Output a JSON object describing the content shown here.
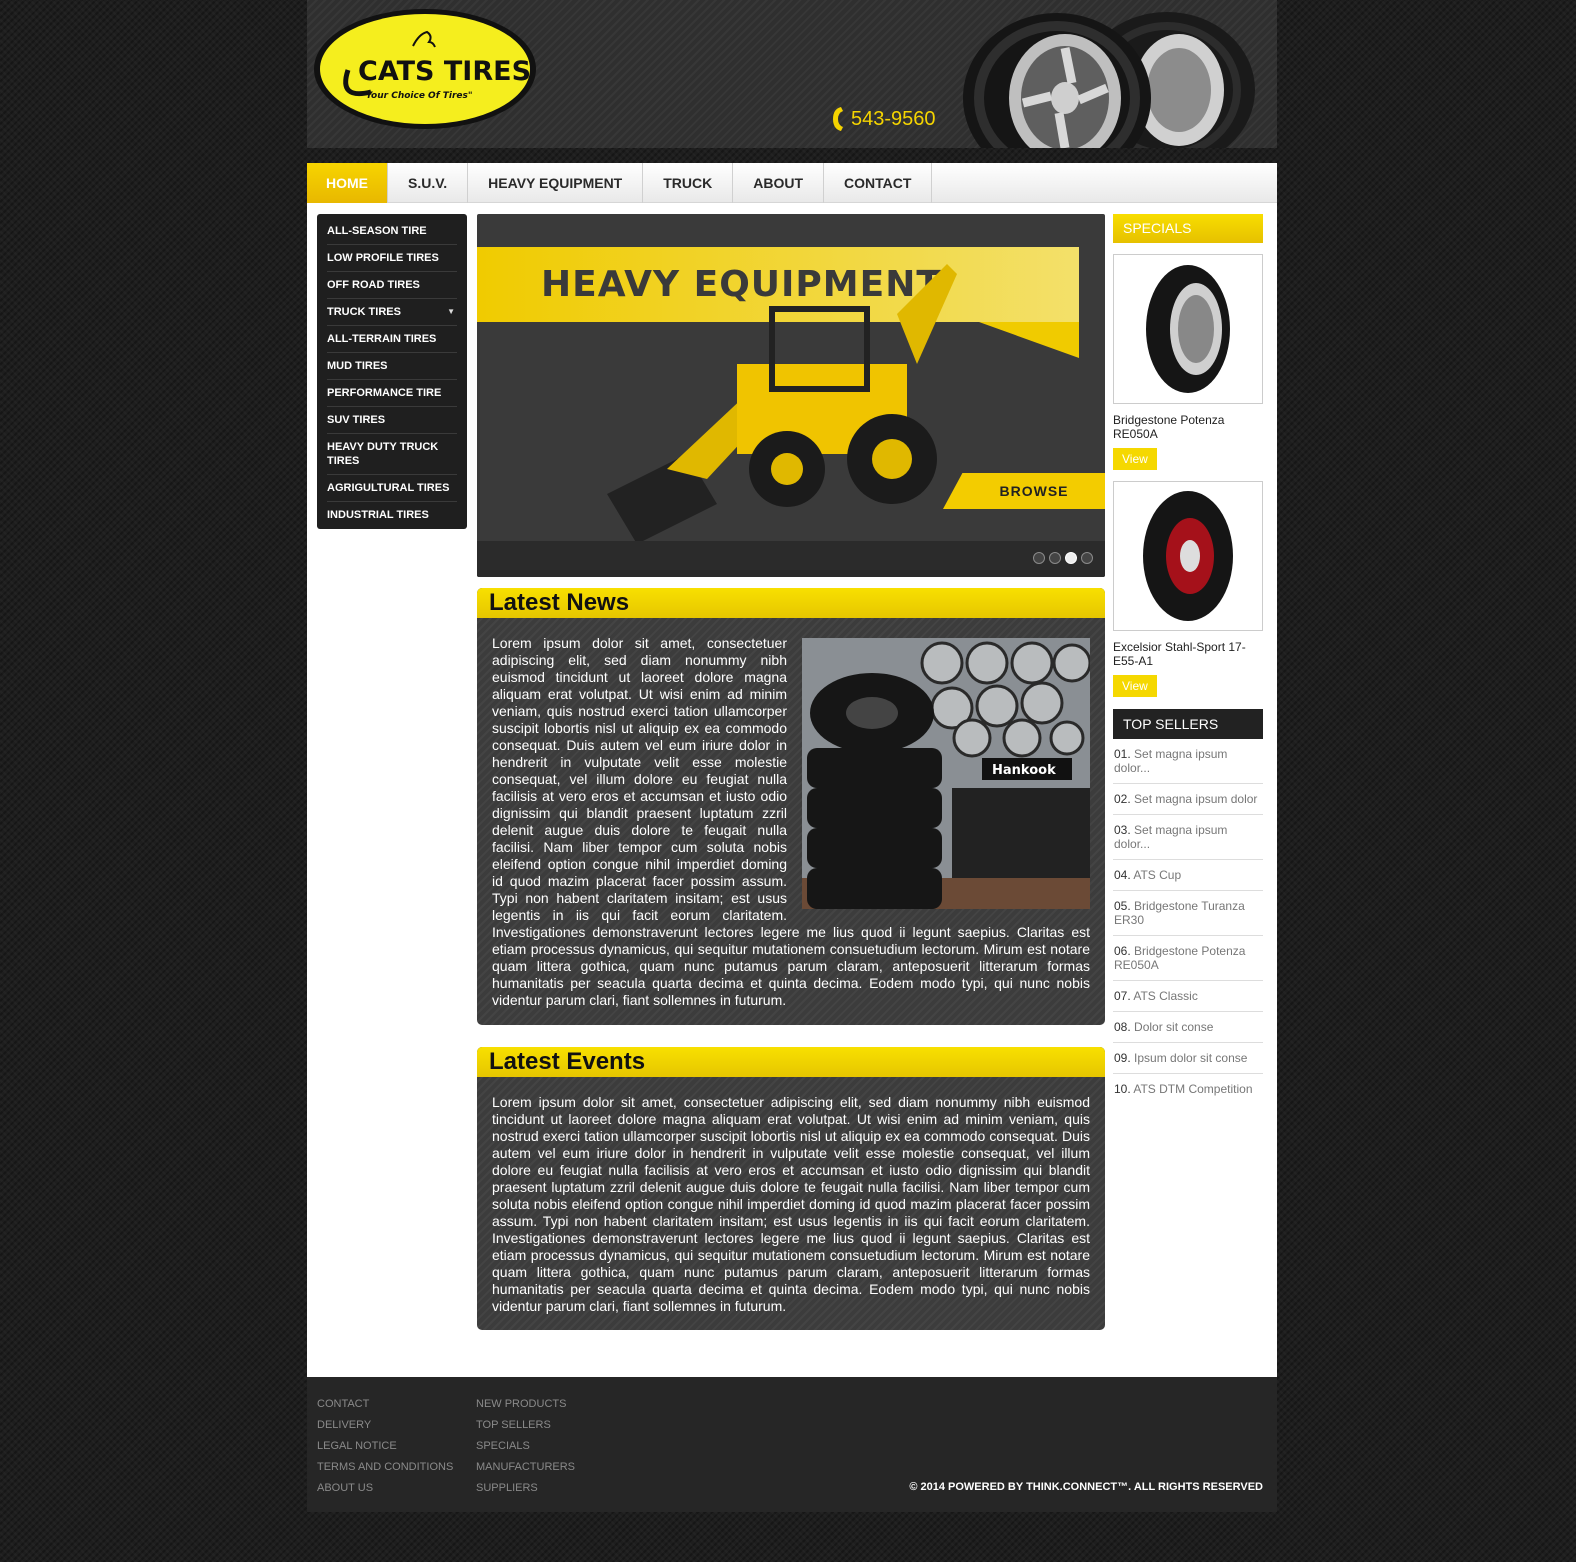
{
  "brand": {
    "name": "CATS TIRES",
    "tagline": "\"Your Choice Of Tires\"",
    "phone": "543-9560"
  },
  "nav": {
    "items": [
      "HOME",
      "S.U.V.",
      "HEAVY EQUIPMENT",
      "TRUCK",
      "ABOUT",
      "CONTACT"
    ],
    "active": "HOME"
  },
  "categories": [
    "ALL-SEASON TIRE",
    "LOW PROFILE TIRES",
    "OFF ROAD TIRES",
    "TRUCK TIRES",
    "ALL-TERRAIN TIRES",
    "MUD TIRES",
    "PERFORMANCE TIRE",
    "SUV TIRES",
    "HEAVY DUTY TRUCK TIRES",
    "AGRIGULTURAL TIRES",
    "INDUSTRIAL TIRES"
  ],
  "slider": {
    "title": "HEAVY EQUIPMENT",
    "button": "BROWSE",
    "dot_count": 4,
    "active_dot": 3
  },
  "news": {
    "title": "Latest News",
    "text": "Lorem ipsum dolor sit amet, consectetuer adipiscing elit, sed diam nonummy nibh euismod tincidunt ut laoreet dolore magna aliquam erat volutpat. Ut wisi enim ad minim veniam, quis nostrud exerci tation ullamcorper suscipit lobortis nisl ut aliquip ex ea commodo consequat. Duis autem vel eum iriure dolor in hendrerit in vulputate velit esse molestie consequat, vel illum dolore eu feugiat nulla facilisis at vero eros et accumsan et iusto odio dignissim qui blandit praesent luptatum zzril delenit augue duis dolore te feugait nulla facilisi. Nam liber tempor cum soluta nobis eleifend option congue nihil imperdiet doming id quod mazim placerat facer possim assum. Typi non habent claritatem insitam; est usus legentis in iis qui facit eorum claritatem. Investigationes demonstraverunt lectores legere me lius quod ii legunt saepius. Claritas est etiam processus dynamicus, qui sequitur mutationem consuetudium lectorum. Mirum est notare quam littera gothica, quam nunc putamus parum claram, anteposuerit litterarum formas humanitatis per seacula quarta decima et quinta decima. Eodem modo typi, qui nunc nobis videntur parum clari, fiant sollemnes in futurum."
  },
  "events": {
    "title": "Latest Events",
    "text": "Lorem ipsum dolor sit amet, consectetuer adipiscing elit, sed diam nonummy nibh euismod tincidunt ut laoreet dolore magna aliquam erat volutpat. Ut wisi enim ad minim veniam, quis nostrud exerci tation ullamcorper suscipit lobortis nisl ut aliquip ex ea commodo consequat. Duis autem vel eum iriure dolor in hendrerit in vulputate velit esse molestie consequat, vel illum dolore eu feugiat nulla facilisis at vero eros et accumsan et iusto odio dignissim qui blandit praesent luptatum zzril delenit augue duis dolore te feugait nulla facilisi. Nam liber tempor cum soluta nobis eleifend option congue nihil imperdiet doming id quod mazim placerat facer possim assum. Typi non habent claritatem insitam; est usus legentis in iis qui facit eorum claritatem. Investigationes demonstraverunt lectores legere me lius quod ii legunt saepius. Claritas est etiam processus dynamicus, qui sequitur mutationem consuetudium lectorum. Mirum est notare quam littera gothica, quam nunc putamus parum claram, anteposuerit litterarum formas humanitatis per seacula quarta decima et quinta decima. Eodem modo typi, qui nunc nobis videntur parum clari, fiant sollemnes in futurum."
  },
  "specials": {
    "title": "SPECIALS",
    "products": [
      {
        "name": "Bridgestone Potenza RE050A",
        "button": "View"
      },
      {
        "name": "Excelsior Stahl-Sport 17-E55-A1",
        "button": "View"
      }
    ]
  },
  "top_sellers": {
    "title": "TOP SELLERS",
    "items": [
      {
        "num": "01.",
        "label": "Set magna ipsum dolor..."
      },
      {
        "num": "02.",
        "label": "Set magna ipsum dolor"
      },
      {
        "num": "03.",
        "label": "Set magna ipsum dolor..."
      },
      {
        "num": "04.",
        "label": "ATS Cup"
      },
      {
        "num": "05.",
        "label": "Bridgestone Turanza ER30"
      },
      {
        "num": "06.",
        "label": "Bridgestone Potenza RE050A"
      },
      {
        "num": "07.",
        "label": "ATS Classic"
      },
      {
        "num": "08.",
        "label": "Dolor sit conse"
      },
      {
        "num": "09.",
        "label": "Ipsum dolor sit conse"
      },
      {
        "num": "10.",
        "label": "ATS DTM Competition"
      }
    ]
  },
  "footer": {
    "col1": [
      "CONTACT",
      "DELIVERY",
      "LEGAL NOTICE",
      "TERMS AND CONDITIONS",
      "ABOUT US"
    ],
    "col2": [
      "NEW PRODUCTS",
      "TOP SELLERS",
      "SPECIALS",
      "MANUFACTURERS",
      "SUPPLIERS"
    ],
    "copyright": "© 2014 POWERED BY THINK.CONNECT™. ALL RIGHTS RESERVED"
  },
  "colors": {
    "accent": "#f5d400",
    "dark": "#1f1f1f"
  }
}
